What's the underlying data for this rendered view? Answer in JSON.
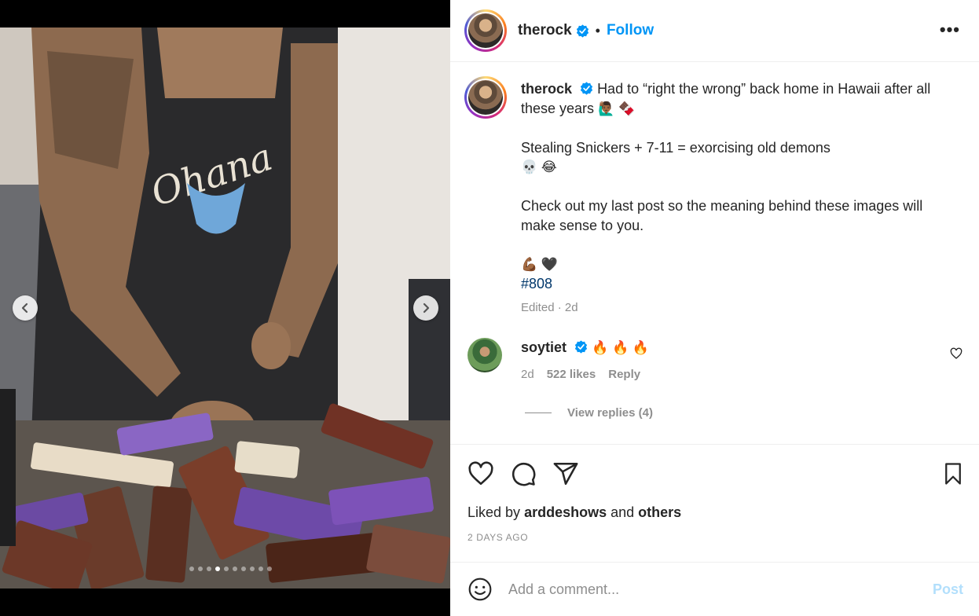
{
  "post": {
    "username": "therock",
    "follow_label": "Follow",
    "separator": "•",
    "more_label": "•••",
    "caption": {
      "username": "therock",
      "line1": "Had to “right the wrong” back home in Hawaii after all these years",
      "line1_emoji": "🙋🏾‍♂️ 🍫",
      "line2": "Stealing Snickers + 7-11 = exorcising old demons",
      "line2_emoji": "💀 😂",
      "line3": "Check out my last post so the meaning behind these images will make sense to you.",
      "line4_emoji": "💪🏾 🖤",
      "hashtag": "#808",
      "edited": "Edited · 2d"
    },
    "comment": {
      "username": "soytiet",
      "text": "🔥 🔥 🔥",
      "time": "2d",
      "likes": "522 likes",
      "reply_label": "Reply",
      "view_replies": "View replies (4)"
    },
    "liked_by_prefix": "Liked by",
    "liked_by_user": "arddeshows",
    "liked_by_and": "and",
    "liked_by_others": "others",
    "date": "2 DAYS AGO",
    "add_comment_placeholder": "Add a comment...",
    "post_label": "Post"
  },
  "carousel": {
    "total": 10,
    "active_index": 3
  },
  "colors": {
    "accent": "#0095f6",
    "link": "#00376b",
    "muted": "#8e8e8e",
    "post_disabled": "#b2dffc"
  },
  "icons": [
    "verified-badge-icon",
    "more-options-icon",
    "heart-icon",
    "comment-icon",
    "share-icon",
    "bookmark-icon",
    "emoji-icon",
    "chevron-left-icon",
    "chevron-right-icon"
  ]
}
